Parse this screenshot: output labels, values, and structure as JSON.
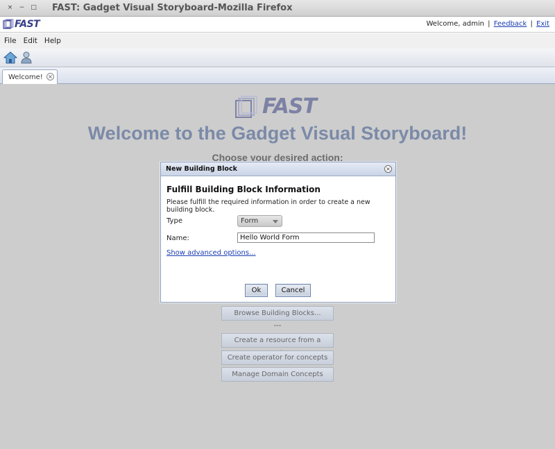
{
  "window": {
    "title": "FAST: Gadget Visual Storyboard-Mozilla Firefox",
    "btn_close": "×",
    "btn_min": "−",
    "btn_max": "□"
  },
  "header": {
    "logo_text": "FAST",
    "welcome_user": "Welcome, admin",
    "sep1": "|",
    "sep2": "|",
    "feedback_link": "Feedback",
    "exit_link": "Exit"
  },
  "menu": {
    "items": [
      "File",
      "Edit",
      "Help"
    ]
  },
  "toolbar": {
    "icons": [
      "home-icon",
      "user-icon"
    ]
  },
  "tabs": [
    {
      "label": "Welcome!",
      "close": "×"
    }
  ],
  "main": {
    "logo_text": "FAST",
    "heading": "Welcome to the Gadget Visual Storyboard!",
    "subheading": "Choose your desired action:",
    "buttons": [
      "Browse Building Blocks...",
      "Create a resource from a service",
      "Create operator for concepts",
      "Manage Domain Concepts"
    ],
    "separator": "---"
  },
  "dialog": {
    "title": "New Building Block",
    "close": "×",
    "heading": "Fulfill Building Block Information",
    "description": "Please fulfill the required information in order to create a new building block.",
    "type_label": "Type",
    "type_value": "Form",
    "name_label": "Name:",
    "name_value": "Hello World Form",
    "advanced_link": "Show advanced options...",
    "ok_label": "Ok",
    "cancel_label": "Cancel"
  }
}
